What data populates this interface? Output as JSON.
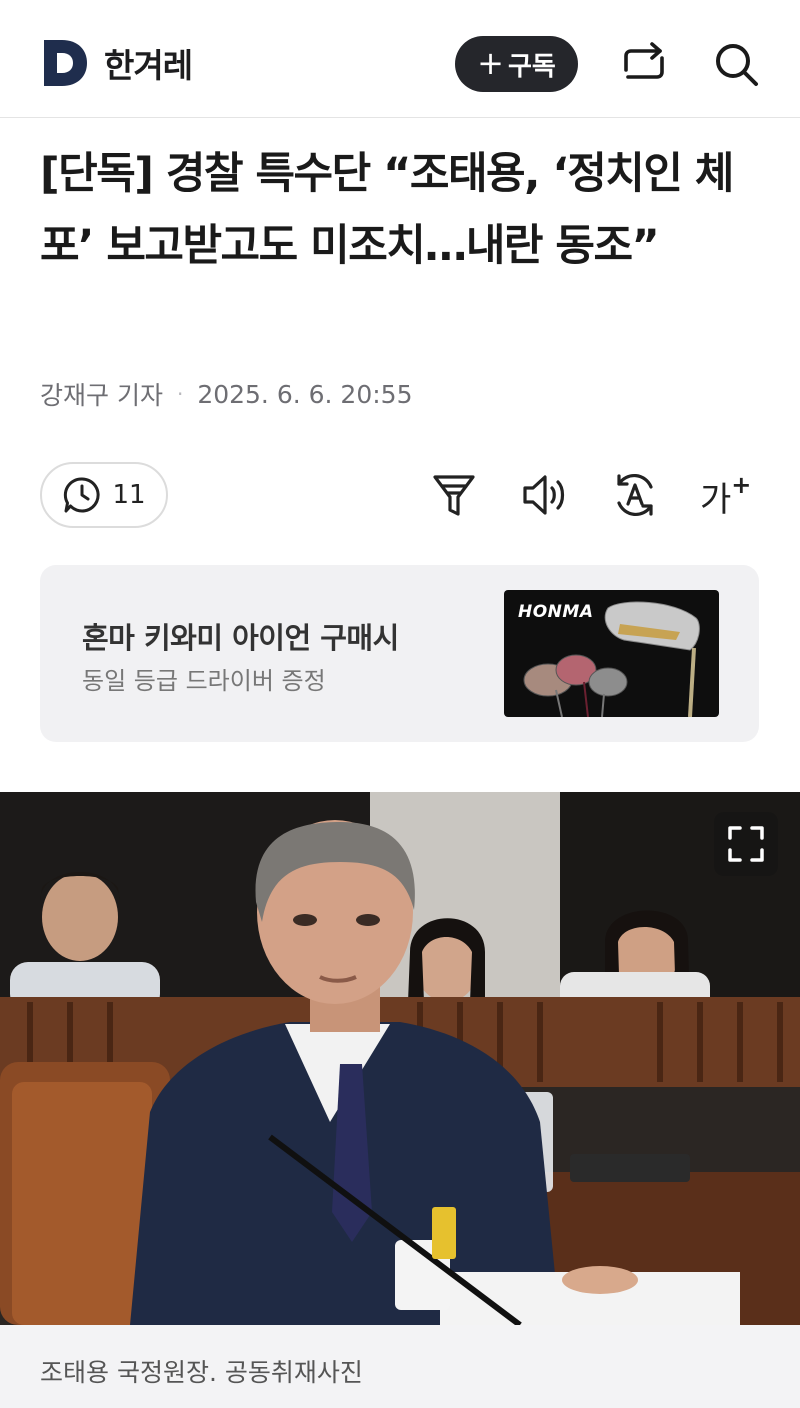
{
  "header": {
    "brand": "한겨레",
    "subscribe_label": "구독",
    "subscribe_plus": "+",
    "icons": [
      "logo-d-icon",
      "share-icon",
      "search-icon"
    ]
  },
  "article": {
    "title": "[단독] 경찰 특수단 “조태용, ‘정치인 체포’ 보고받고도 미조치…내란 동조”",
    "reporter": "강재구 기자",
    "separator": "·",
    "date": "2025. 6. 6. 20:55"
  },
  "toolbar": {
    "comment_count": "11",
    "font_size_label": "가",
    "font_size_plus": "+",
    "icons": [
      "comment-clock-icon",
      "filter-icon",
      "speaker-icon",
      "translate-icon",
      "font-size-icon"
    ]
  },
  "ad": {
    "title": "혼마 키와미 아이언 구매시",
    "subtitle": "동일 등급 드라이버 증정",
    "brand_logo": "HONMA"
  },
  "photo": {
    "caption": "조태용 국정원장. 공동취재사진",
    "expand_icon": "fullscreen-icon"
  },
  "colors": {
    "subscribe_bg": "#25262b",
    "logo_navy": "#1f2d4d",
    "ad_bg": "#f1f1f3",
    "caption_bg": "#f3f3f5"
  }
}
